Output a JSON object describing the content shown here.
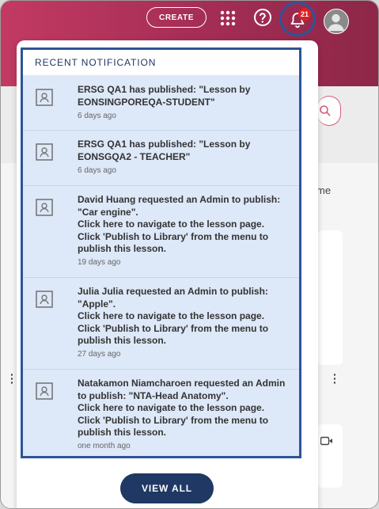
{
  "header": {
    "create_label": "CREATE",
    "notification_count": "21",
    "apps_icon": "grid-icon",
    "help_icon": "help-icon",
    "bell_icon": "bell-icon",
    "avatar_icon": "user-avatar"
  },
  "background": {
    "partial_text": "me"
  },
  "notifications_panel": {
    "title": "RECENT NOTIFICATION",
    "items": [
      {
        "text": "ERSG QA1 has published: \"Lesson by EONSINGPOREQA-STUDENT\"",
        "time": "6 days ago"
      },
      {
        "text": "ERSG QA1 has published: \"Lesson by EONSGQA2 - TEACHER\"",
        "time": "6 days ago"
      },
      {
        "text": "David Huang requested an Admin to publish: \"Car engine\".\nClick here to navigate to the lesson page.\nClick 'Publish to Library' from the menu to publish this lesson.",
        "time": "19 days ago"
      },
      {
        "text": "Julia Julia requested an Admin to publish: \"Apple\".\nClick here to navigate to the lesson page.\nClick 'Publish to Library' from the menu to publish this lesson.",
        "time": "27 days ago"
      },
      {
        "text": "Natakamon Niamcharoen requested an Admin to publish: \"NTA-Head Anatomy\".\nClick here to navigate to the lesson page.\nClick 'Publish to Library' from the menu to publish this lesson.",
        "time": "one month ago"
      }
    ],
    "view_all_label": "VIEW ALL"
  },
  "colors": {
    "header_gradient_start": "#c23a63",
    "header_gradient_end": "#8d2748",
    "accent_navy": "#1f3864",
    "highlight_border": "#2f5496",
    "notification_bg": "#dde8f8",
    "badge_red": "#e02020"
  }
}
